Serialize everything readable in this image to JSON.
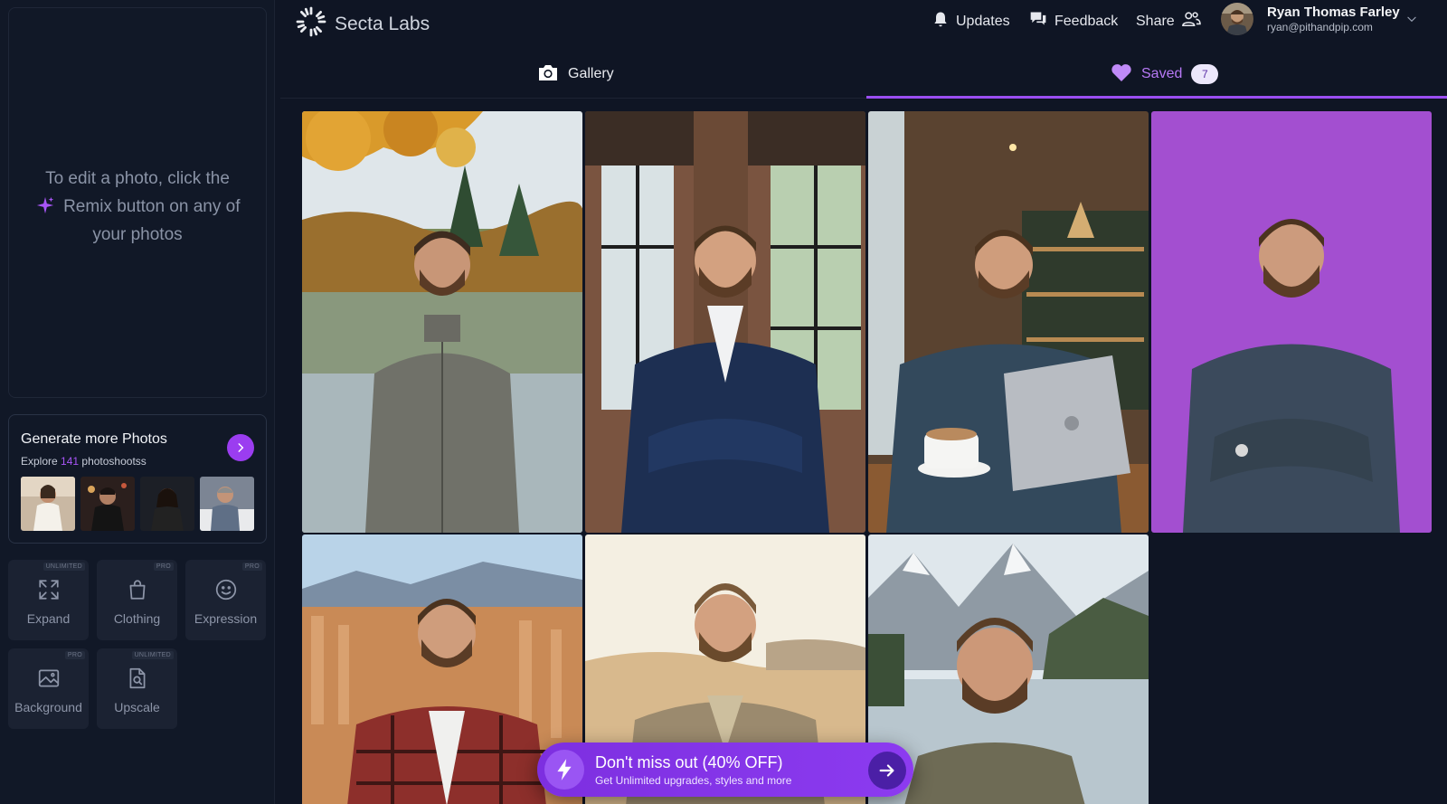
{
  "header": {
    "brand_name": "Secta Labs",
    "updates_label": "Updates",
    "feedback_label": "Feedback",
    "share_label": "Share",
    "user_name": "Ryan Thomas Farley",
    "user_email": "ryan@pithandpip.com"
  },
  "tabs": {
    "gallery_label": "Gallery",
    "saved_label": "Saved",
    "saved_count": "7"
  },
  "sidebar": {
    "edit_hint_line1": "To edit a photo, click the",
    "edit_hint_line2": "Remix button on any of",
    "edit_hint_line3": "your photos",
    "generate": {
      "title": "Generate more Photos",
      "sub_prefix": "Explore",
      "count": "141",
      "sub_suffix": "photoshootss"
    },
    "tools": [
      {
        "label": "Expand",
        "badge": "UNLIMITED",
        "icon": "expand-icon"
      },
      {
        "label": "Clothing",
        "badge": "PRO",
        "icon": "shopping-bag-icon"
      },
      {
        "label": "Expression",
        "badge": "PRO",
        "icon": "smiley-icon"
      },
      {
        "label": "Background",
        "badge": "PRO",
        "icon": "image-icon"
      },
      {
        "label": "Upscale",
        "badge": "UNLIMITED",
        "icon": "file-search-icon"
      }
    ]
  },
  "photos": [
    {
      "scene": "autumn-lake"
    },
    {
      "scene": "brick-office"
    },
    {
      "scene": "coffee-shop-laptop"
    },
    {
      "scene": "purple-backdrop"
    },
    {
      "scene": "canyon-hoodoos"
    },
    {
      "scene": "desert-dunes"
    },
    {
      "scene": "mountain-lake"
    }
  ],
  "promo": {
    "title": "Don't miss out (40% OFF)",
    "subtitle": "Get Unlimited upgrades, styles and more"
  },
  "colors": {
    "accent": "#9b4ef2",
    "background": "#0f1524",
    "sidebar": "#111827"
  }
}
